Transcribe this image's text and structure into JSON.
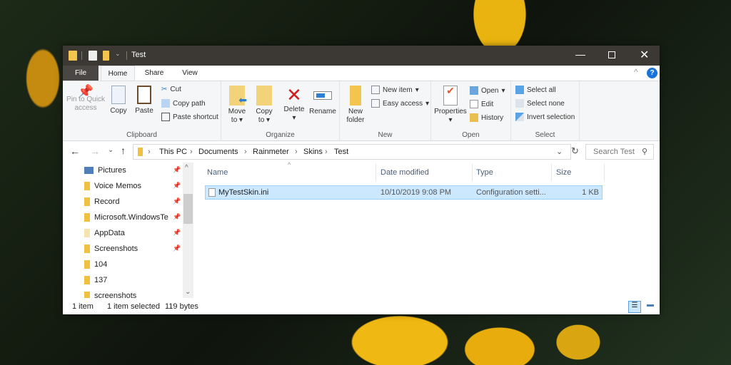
{
  "window": {
    "title": "Test"
  },
  "tabs": [
    "File",
    "Home",
    "Share",
    "View"
  ],
  "ribbon": {
    "clipboard": {
      "label": "Clipboard",
      "pin": "Pin to Quick access",
      "copy": "Copy",
      "paste": "Paste",
      "cut": "Cut",
      "copy_path": "Copy path",
      "paste_shortcut": "Paste shortcut"
    },
    "organize": {
      "label": "Organize",
      "move_to": "Move to",
      "copy_to": "Copy to",
      "delete": "Delete",
      "rename": "Rename"
    },
    "new": {
      "label": "New",
      "new_folder": "New folder",
      "new_item": "New item",
      "easy_access": "Easy access"
    },
    "open": {
      "label": "Open",
      "properties": "Properties",
      "open": "Open",
      "edit": "Edit",
      "history": "History"
    },
    "select": {
      "label": "Select",
      "select_all": "Select all",
      "select_none": "Select none",
      "invert": "Invert selection"
    }
  },
  "address": {
    "crumbs": [
      "This PC",
      "Documents",
      "Rainmeter",
      "Skins",
      "Test"
    ],
    "search_placeholder": "Search Test"
  },
  "nav": [
    {
      "label": "Pictures",
      "pinned": true
    },
    {
      "label": "Voice Memos",
      "pinned": true
    },
    {
      "label": "Record",
      "pinned": true
    },
    {
      "label": "Microsoft.WindowsTe",
      "pinned": true
    },
    {
      "label": "AppData",
      "pinned": true
    },
    {
      "label": "Screenshots",
      "pinned": true
    },
    {
      "label": "104",
      "pinned": false
    },
    {
      "label": "137",
      "pinned": false
    },
    {
      "label": "screenshots",
      "pinned": false
    }
  ],
  "columns": [
    "Name",
    "Date modified",
    "Type",
    "Size"
  ],
  "files": [
    {
      "name": "MyTestSkin.ini",
      "date": "10/10/2019 9:08 PM",
      "type": "Configuration setti...",
      "size": "1 KB",
      "selected": true
    }
  ],
  "status": {
    "count": "1 item",
    "selected": "1 item selected",
    "size": "119 bytes"
  },
  "colors": {
    "selection": "#cce8ff",
    "titlebar": "#3c3935"
  }
}
